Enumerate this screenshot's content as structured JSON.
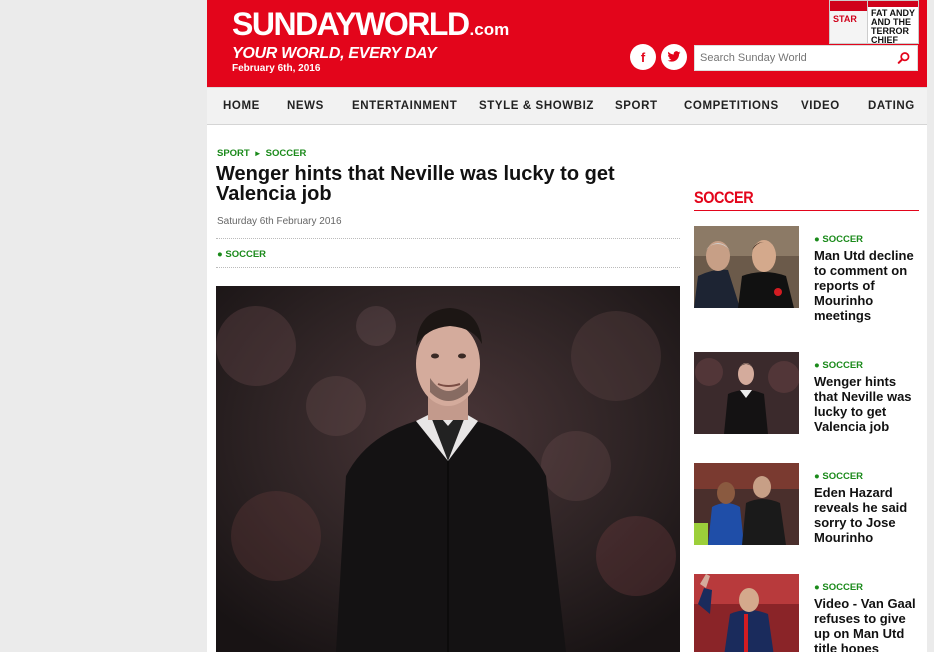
{
  "header": {
    "logo_main": "SUNDAYWORLD",
    "logo_domain": ".com",
    "tagline": "YOUR WORLD, EVERY DAY",
    "date": "February 6th, 2016",
    "paper_headline": "FAT ANDY AND THE TERROR CHIEF",
    "paper_masthead": "STAR",
    "search_placeholder": "Search Sunday World",
    "social": [
      "facebook-icon",
      "twitter-icon"
    ]
  },
  "nav": {
    "items": [
      "HOME",
      "NEWS",
      "ENTERTAINMENT",
      "STYLE & SHOWBIZ",
      "SPORT",
      "COMPETITIONS",
      "VIDEO",
      "DATING"
    ]
  },
  "article": {
    "breadcrumb": [
      "SPORT",
      "SOCCER"
    ],
    "title": "Wenger hints that Neville was lucky to get Valencia job",
    "date": "Saturday 6th February 2016",
    "tag": "SOCCER"
  },
  "sidebar": {
    "title": "SOCCER",
    "items": [
      {
        "tag": "SOCCER",
        "title": "Man Utd decline to comment on reports of Mourinho meetings"
      },
      {
        "tag": "SOCCER",
        "title": "Wenger hints that Neville was lucky to get Valencia job"
      },
      {
        "tag": "SOCCER",
        "title": "Eden Hazard reveals he said sorry to Jose Mourinho"
      },
      {
        "tag": "SOCCER",
        "title": "Video - Van Gaal refuses to give up on Man Utd title hopes"
      }
    ]
  },
  "colors": {
    "brand_red": "#e3051b",
    "tag_green": "#1a8a1a",
    "nav_bg": "#f2f2f2",
    "page_bg": "#ebebeb"
  }
}
